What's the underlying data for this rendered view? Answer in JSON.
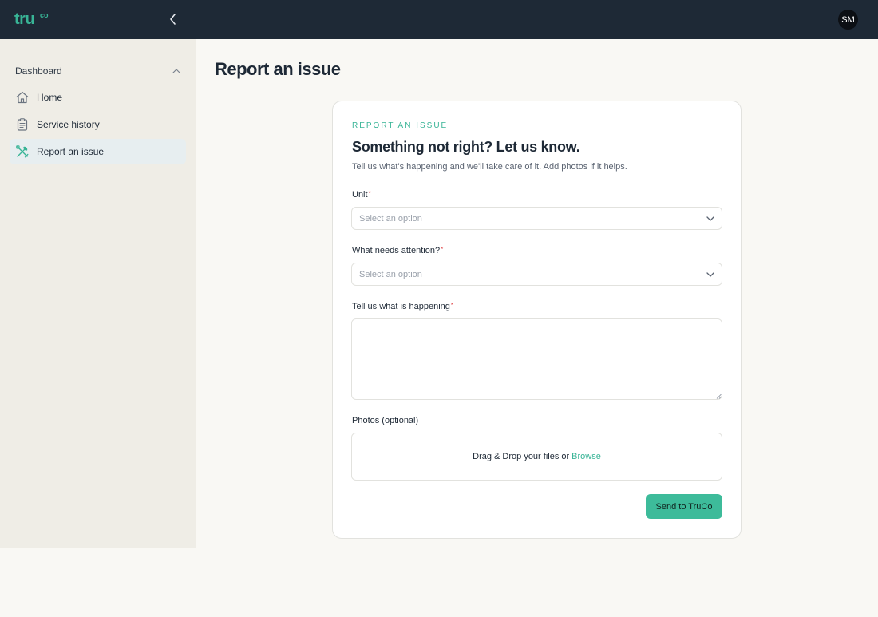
{
  "brand": {
    "logo_text": "tru",
    "logo_sup": "co"
  },
  "header": {
    "avatar_initials": "SM"
  },
  "sidebar": {
    "group_label": "Dashboard",
    "items": [
      {
        "label": "Home",
        "icon": "home-icon",
        "active": false
      },
      {
        "label": "Service history",
        "icon": "clipboard-icon",
        "active": false
      },
      {
        "label": "Report an issue",
        "icon": "tools-icon",
        "active": true
      }
    ]
  },
  "page": {
    "title": "Report an issue"
  },
  "form": {
    "eyebrow": "REPORT AN ISSUE",
    "headline": "Something not right? Let us know.",
    "subtext": "Tell us what's happening and we'll take care of it. Add photos if it helps.",
    "required_mark": "*",
    "unit": {
      "label": "Unit",
      "placeholder": "Select an option"
    },
    "attention": {
      "label": "What needs attention?",
      "placeholder": "Select an option"
    },
    "description": {
      "label": "Tell us what is happening",
      "value": ""
    },
    "photos": {
      "label": "Photos (optional)",
      "drop_text": "Drag & Drop your files or",
      "browse_label": "Browse"
    },
    "submit_label": "Send to TruCo"
  },
  "colors": {
    "accent": "#38b496",
    "topbar": "#1e2936",
    "sidebar": "#efede6",
    "background": "#f9f8f4",
    "required": "#e0484a"
  }
}
